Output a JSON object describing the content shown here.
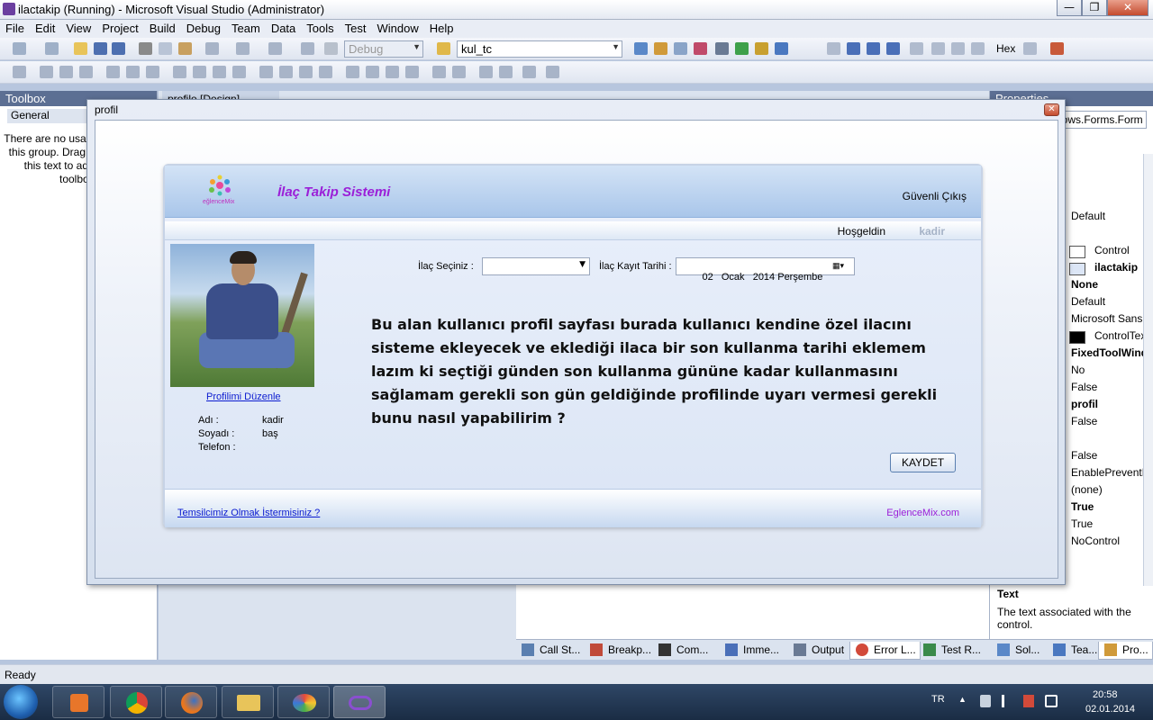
{
  "window": {
    "title": "ilactakip (Running) - Microsoft Visual Studio (Administrator)",
    "min": "—",
    "max": "❐",
    "close": "✕"
  },
  "menu": [
    "File",
    "Edit",
    "View",
    "Project",
    "Build",
    "Debug",
    "Team",
    "Data",
    "Tools",
    "Test",
    "Window",
    "Help"
  ],
  "toolbar": {
    "config_combo": "Debug",
    "find_combo": "kul_tc",
    "hex_label": "Hex"
  },
  "toolbox": {
    "title": "Toolbox",
    "group": "General",
    "message": "There are no usable controls in this group. Drag an item onto this text to add it to the toolbox."
  },
  "doc_tab": "profile [Design]",
  "properties": {
    "title": "Properties",
    "object": "System.Windows.Forms.Form",
    "values": [
      "Default",
      "Control",
      "ilactakip",
      "None",
      "Default",
      "Microsoft Sans",
      "ControlText",
      "FixedToolWindow",
      "No",
      "False",
      "profil",
      "False",
      "False",
      "EnablePreventFocusChange",
      "(none)",
      "True",
      "True",
      "NoControl"
    ],
    "desc_title": "Text",
    "desc_text": "The text associated with the control."
  },
  "bottom_tabs": [
    "Call St...",
    "Breakp...",
    "Com...",
    "Imme...",
    "Output",
    "Error L...",
    "Test R...",
    "Sol...",
    "Tea...",
    "Pro..."
  ],
  "status": "Ready",
  "tray": {
    "lang": "TR",
    "time": "20:58",
    "date": "02.01.2014"
  },
  "form": {
    "title": "profil",
    "app_title": "İlaç Takip Sistemi",
    "logo_text": "eğlenceMix",
    "logout": "Güvenli Çıkış",
    "welcome": "Hoşgeldin",
    "welcome_user": "kadir",
    "edit_profile": "Profilimi Düzenle",
    "fields": [
      {
        "label": "Adı :",
        "value": "kadir"
      },
      {
        "label": "Soyadı :",
        "value": "baş"
      },
      {
        "label": "Telefon :",
        "value": ""
      }
    ],
    "drug_label": "İlaç Seçiniz :",
    "drug_value": "",
    "date_label": "İlaç Kayıt Tarihi :",
    "date_value": "02   Ocak   2014 Perşembe",
    "question": "Bu alan kullanıcı profil sayfası burada kullanıcı kendine özel ilacını sisteme ekleyecek ve eklediği ilaca bir son kullanma tarihi eklemem lazım ki seçtiği günden son kullanma gününe kadar kullanmasını sağlamam gerekli son gün geldiğinde profilinde uyarı vermesi gerekli bunu nasıl yapabilirim ?",
    "save": "KAYDET",
    "rep_link": "Temsilcimiz Olmak İstermisiniz ?",
    "brand": "EglenceMix.com"
  },
  "colors": {
    "accent": "#9b1fd8",
    "link": "#0b1bd0"
  }
}
